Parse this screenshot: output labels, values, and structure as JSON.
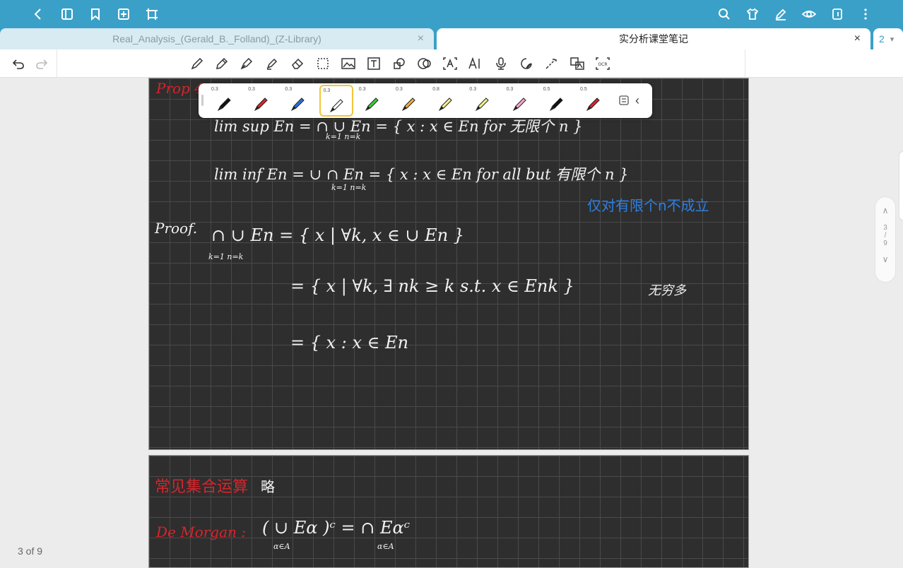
{
  "tabs": [
    {
      "label": "Real_Analysis_(Gerald_B._Folland)_(Z-Library)",
      "close": "×"
    },
    {
      "label": "实分析课堂笔记",
      "close": "×"
    }
  ],
  "tab_count": "2",
  "tab_count_caret": "▾",
  "palette": {
    "pens": [
      {
        "size": "0.3",
        "color": "#111111"
      },
      {
        "size": "0.3",
        "color": "#d8242b"
      },
      {
        "size": "0.3",
        "color": "#2e6fd8"
      },
      {
        "size": "0.3",
        "color": "#ffffff"
      },
      {
        "size": "0.3",
        "color": "#3ccf3a"
      },
      {
        "size": "0.3",
        "color": "#f2a93a"
      },
      {
        "size": "0.8",
        "color": "#f4ef8a"
      },
      {
        "size": "0.3",
        "color": "#eef08a"
      },
      {
        "size": "0.3",
        "color": "#f4a6d0"
      },
      {
        "size": "0.5",
        "color": "#111111"
      },
      {
        "size": "0.5",
        "color": "#d8242b"
      }
    ],
    "collapse": "‹"
  },
  "note1": {
    "l1": "Prop 4",
    "l2": "lim sup En = ∩ ∪ En = { x : x ∈ En for 无限个 n }",
    "l2b": "k=1 n=k",
    "l3": "lim inf En = ∪ ∩ En = { x : x ∈ En for all but 有限个 n }",
    "l3b": "k=1 n=k",
    "l4": "仅对有限个n不成立",
    "l5": "Proof.",
    "l6": "∩ ∪ En = { x | ∀k, x ∈ ∪ En }",
    "l6b": "k=1 n=k",
    "l7": "= { x | ∀k, ∃ nk ≥ k s.t. x ∈ Enk }",
    "l7b": "无穷多",
    "l8": "= { x : x ∈ En"
  },
  "note2": {
    "title": "常见集合运算",
    "title_note": "略",
    "dm": "De Morgan :",
    "dm_eq": "( ∪ Eα )ᶜ = ∩ Eαᶜ",
    "dm_sub": "α∈A α∈A"
  },
  "scroller": {
    "up": "∧",
    "current": "3",
    "sep": "/",
    "total": "9",
    "down": "∨"
  },
  "page_indicator": "3 of 9",
  "colors": {
    "accent": "#3aa0c8",
    "note_bg": "#2e2e2e",
    "red_ink": "#d8242b",
    "blue_ink": "#2e7fe0"
  }
}
